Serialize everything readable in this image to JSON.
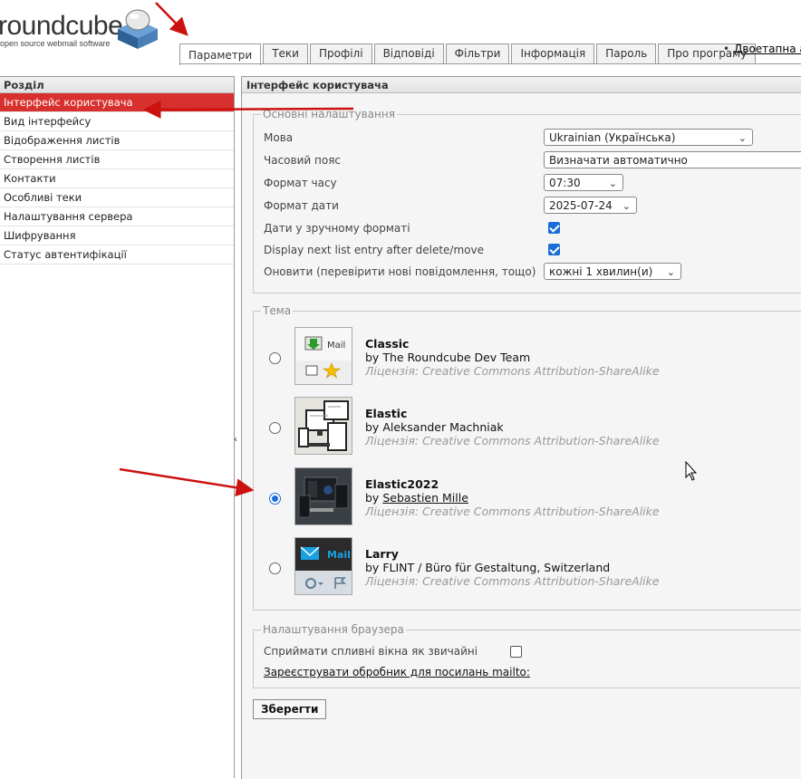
{
  "logo": {
    "word": "roundcube",
    "sub": "open source webmail software"
  },
  "tabs": [
    {
      "label": "Параметри",
      "active": true
    },
    {
      "label": "Теки"
    },
    {
      "label": "Профілі"
    },
    {
      "label": "Відповіді"
    },
    {
      "label": "Фільтри"
    },
    {
      "label": "Інформація"
    },
    {
      "label": "Пароль"
    },
    {
      "label": "Про програму"
    }
  ],
  "top_link": "Двоетапна а",
  "left": {
    "header": "Розділ",
    "items": [
      "Інтерфейс користувача",
      "Вид інтерфейсу",
      "Відображення листів",
      "Створення листів",
      "Контакти",
      "Особливі теки",
      "Налаштування сервера",
      "Шифрування",
      "Статус автентифікації"
    ]
  },
  "right": {
    "header": "Інтерфейс користувача",
    "basic": {
      "legend": "Основні налаштування",
      "language_label": "Мова",
      "language_value": "Ukrainian (Українська)",
      "timezone_label": "Часовий пояс",
      "timezone_value": "Визначати автоматично",
      "timeformat_label": "Формат часу",
      "timeformat_value": "07:30",
      "dateformat_label": "Формат дати",
      "dateformat_value": "2025-07-24",
      "prettydate_label": "Дати у зручному форматі",
      "displaynext_label": "Display next list entry after delete/move",
      "refresh_label": "Оновити (перевірити нові повідомлення, тощо)",
      "refresh_value": "кожні 1 хвилин(и)"
    },
    "theme": {
      "legend": "Тема",
      "license_prefix": "Ліцензія: ",
      "skins": [
        {
          "name": "Classic",
          "author_prefix": "by ",
          "author": "The Roundcube Dev Team",
          "license": "Creative Commons Attribution-ShareAlike",
          "selected": false
        },
        {
          "name": "Elastic",
          "author_prefix": "by ",
          "author": "Aleksander Machniak",
          "license": "Creative Commons Attribution-ShareAlike",
          "selected": false
        },
        {
          "name": "Elastic2022",
          "author_prefix": "by ",
          "author": "Sebastien Mille",
          "license": "Creative Commons Attribution-ShareAlike",
          "selected": true
        },
        {
          "name": "Larry",
          "author_prefix": "by ",
          "author": "FLINT / Büro für Gestaltung, Switzerland",
          "license": "Creative Commons Attribution-ShareAlike",
          "selected": false
        }
      ],
      "thumb_text": {
        "classic": "Mail",
        "larry": "Mail"
      }
    },
    "browser": {
      "legend": "Налаштування браузера",
      "popup_label": "Сприймати спливні вікна як звичайні",
      "mailto_link": "Зареєструвати обробник для посилань mailto:"
    },
    "save_label": "Зберегти"
  },
  "colors": {
    "active_item": "#d8302e",
    "checkbox": "#1a6dd8",
    "annotation_arrow": "#cc1111"
  }
}
